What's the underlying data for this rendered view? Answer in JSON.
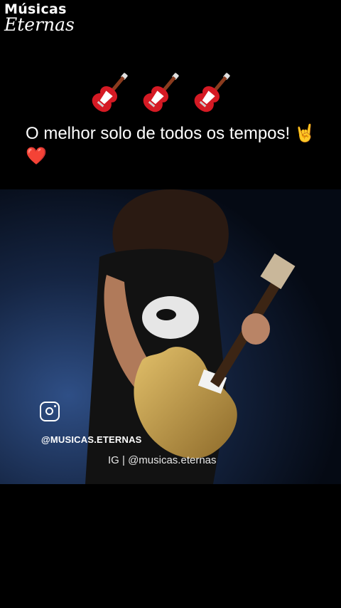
{
  "logo": {
    "line1": "Músicas",
    "line2": "Eternas"
  },
  "header": {
    "icons": [
      "guitar-icon",
      "guitar-icon",
      "guitar-icon"
    ]
  },
  "caption": {
    "text": "O melhor solo de todos os tempos!",
    "emoji": "🤘❤️"
  },
  "video": {
    "ig_icon": "instagram-icon",
    "handle": "@MUSICAS.ETERNAS",
    "watermark": "IG | @musicas.eternas"
  },
  "colors": {
    "background": "#000000",
    "guitar_red": "#d51a24",
    "stage_blue": "#0b1424"
  }
}
